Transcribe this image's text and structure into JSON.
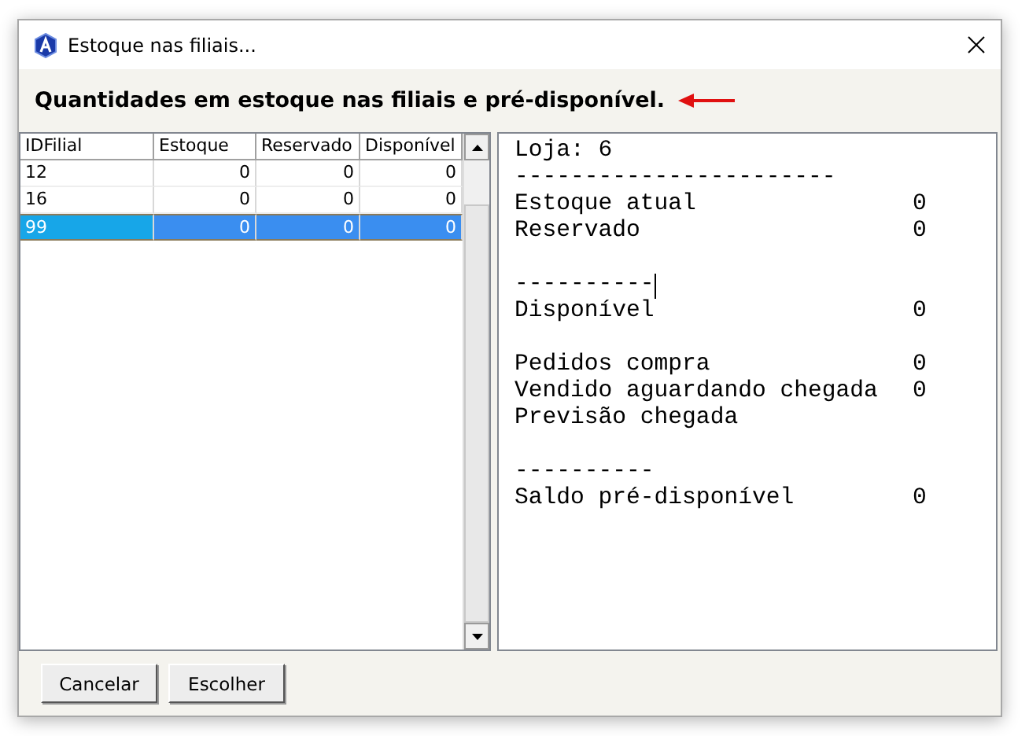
{
  "window": {
    "title": "Estoque nas filiais..."
  },
  "heading": "Quantidades em estoque nas filiais e pré-disponível.",
  "table": {
    "columns": [
      "IDFilial",
      "Estoque",
      "Reservado",
      "Disponível"
    ],
    "rows": [
      {
        "cells": [
          "12",
          "0",
          "0",
          "0"
        ],
        "selected": false
      },
      {
        "cells": [
          "16",
          "0",
          "0",
          "0"
        ],
        "selected": false
      },
      {
        "cells": [
          "99",
          "0",
          "0",
          "0"
        ],
        "selected": true
      }
    ]
  },
  "memo": [
    {
      "label": "Loja: 6",
      "cursor": false
    },
    {
      "label": "-----------------------",
      "cursor": false
    },
    {
      "label": "Estoque atual",
      "value": "0",
      "cursor": false
    },
    {
      "label": "Reservado",
      "value": "0",
      "cursor": false
    },
    {
      "cursor": false
    },
    {
      "label": "----------",
      "cursor": true
    },
    {
      "label": "Disponível",
      "value": "0",
      "cursor": false
    },
    {
      "cursor": false
    },
    {
      "label": "Pedidos compra",
      "value": "0",
      "cursor": false
    },
    {
      "label": "Vendido aguardando chegada",
      "value": "0",
      "cursor": false
    },
    {
      "label": "Previsão chegada",
      "cursor": false
    },
    {
      "cursor": false
    },
    {
      "label": "----------",
      "cursor": false
    },
    {
      "label": "Saldo pré-disponível",
      "value": "0",
      "cursor": false
    }
  ],
  "buttons": [
    "Cancelar",
    "Escolher"
  ]
}
